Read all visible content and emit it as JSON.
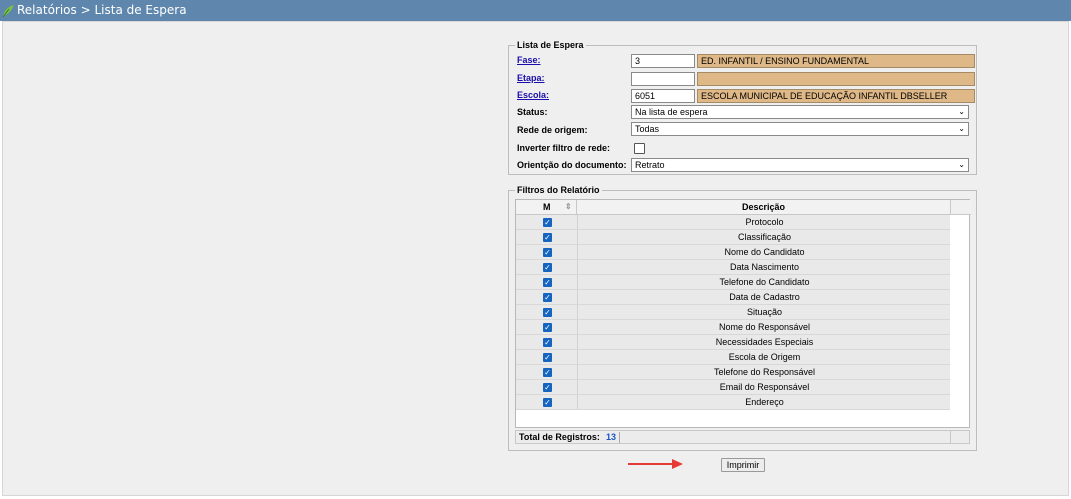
{
  "header": {
    "title": "Relatórios > Lista de Espera",
    "logo_icon": "leaf-logo-icon"
  },
  "form": {
    "legend": "Lista de Espera",
    "fase": {
      "label": "Fase:",
      "code": "3",
      "description": "ED. INFANTIL / ENSINO FUNDAMENTAL"
    },
    "etapa": {
      "label": "Etapa:",
      "code": "",
      "description": ""
    },
    "escola": {
      "label": "Escola:",
      "code": "6051",
      "description": "ESCOLA MUNICIPAL DE EDUCAÇÃO INFANTIL DBSELLER"
    },
    "status": {
      "label": "Status:",
      "value": "Na lista de espera"
    },
    "rede_origem": {
      "label": "Rede de origem:",
      "value": "Todas"
    },
    "inverter": {
      "label": "Inverter filtro de rede:",
      "checked": false
    },
    "orientacao": {
      "label": "Orientção do documento:",
      "value": "Retrato"
    }
  },
  "filters": {
    "legend": "Filtros do Relatório",
    "col_m": "M",
    "col_desc": "Descrição",
    "rows": [
      {
        "label": "Protocolo",
        "checked": true
      },
      {
        "label": "Classificação",
        "checked": true
      },
      {
        "label": "Nome do Candidato",
        "checked": true
      },
      {
        "label": "Data Nascimento",
        "checked": true
      },
      {
        "label": "Telefone do Candidato",
        "checked": true
      },
      {
        "label": "Data de Cadastro",
        "checked": true
      },
      {
        "label": "Situação",
        "checked": true
      },
      {
        "label": "Nome do Responsável",
        "checked": true
      },
      {
        "label": "Necessidades Especiais",
        "checked": true
      },
      {
        "label": "Escola de Origem",
        "checked": true
      },
      {
        "label": "Telefone do Responsável",
        "checked": true
      },
      {
        "label": "Email do Responsável",
        "checked": true
      },
      {
        "label": "Endereço",
        "checked": true
      }
    ],
    "total_label": "Total de Registros:",
    "total_count": "13"
  },
  "actions": {
    "print_label": "Imprimir"
  },
  "colors": {
    "accent": "#5f87ad",
    "readonly_bg": "#deb887",
    "checkbox": "#1565c0",
    "arrow": "#e53935"
  }
}
